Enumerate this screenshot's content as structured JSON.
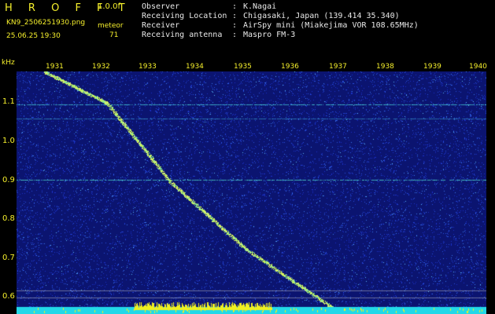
{
  "header": {
    "title": "H R O F F T",
    "version": "1.0.0f",
    "filename": "KN9_2506251930.png",
    "meteor_label": "meteor",
    "datetime": "25.06.25 19:30",
    "meteor_count": "71"
  },
  "info": [
    {
      "key": "Observer",
      "value": "K.Nagai"
    },
    {
      "key": "Receiving Location",
      "value": "Chigasaki, Japan (139.414 35.340)"
    },
    {
      "key": "Receiver",
      "value": "AirSpy mini (Miakejima VOR 108.65MHz)"
    },
    {
      "key": "Receiving antenna",
      "value": "Maspro FM-3"
    }
  ],
  "axis": {
    "unit": "kHz",
    "y_ticks": [
      "1.1",
      "1.0",
      "0.9",
      "0.8",
      "0.7",
      "0.6"
    ],
    "x_ticks": [
      "1931",
      "1932",
      "1933",
      "1934",
      "1935",
      "1936",
      "1937",
      "1938",
      "1939",
      "1940"
    ]
  },
  "colors": {
    "label": "#f5ef2c",
    "background_noise": "#0a1a8c",
    "trace": "#b8f060",
    "baseline": "#22d8e8"
  }
}
